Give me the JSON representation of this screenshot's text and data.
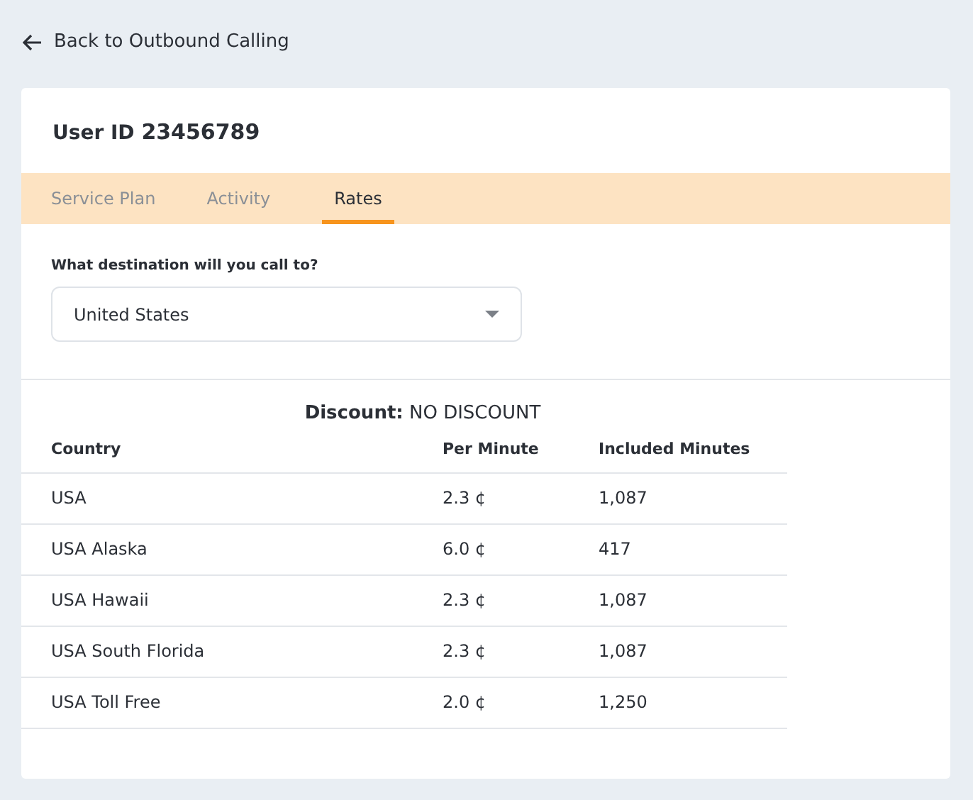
{
  "back_link": "Back to Outbound Calling",
  "user": {
    "label": "User ID",
    "id": "23456789"
  },
  "tabs": [
    {
      "label": "Service Plan",
      "selected": false
    },
    {
      "label": "Activity",
      "selected": false
    },
    {
      "label": "Rates",
      "selected": true
    }
  ],
  "destination": {
    "label": "What destination will you call to?",
    "value": "United States"
  },
  "discount": "**Discount:** NO DISCOUNT",
  "table": {
    "columns": [
      "Country",
      "Per Minute",
      "Included Minutes"
    ],
    "rows": [
      [
        "USA",
        "2.3 ¢",
        "1,087"
      ],
      [
        "USA Alaska",
        "6.0 ¢",
        "417"
      ],
      [
        "USA Hawaii",
        "2.3 ¢",
        "1,087"
      ],
      [
        "USA South Florida",
        "2.3 ¢",
        "1,087"
      ],
      [
        "USA Toll Free",
        "2.0 ¢",
        "1,250"
      ]
    ]
  }
}
